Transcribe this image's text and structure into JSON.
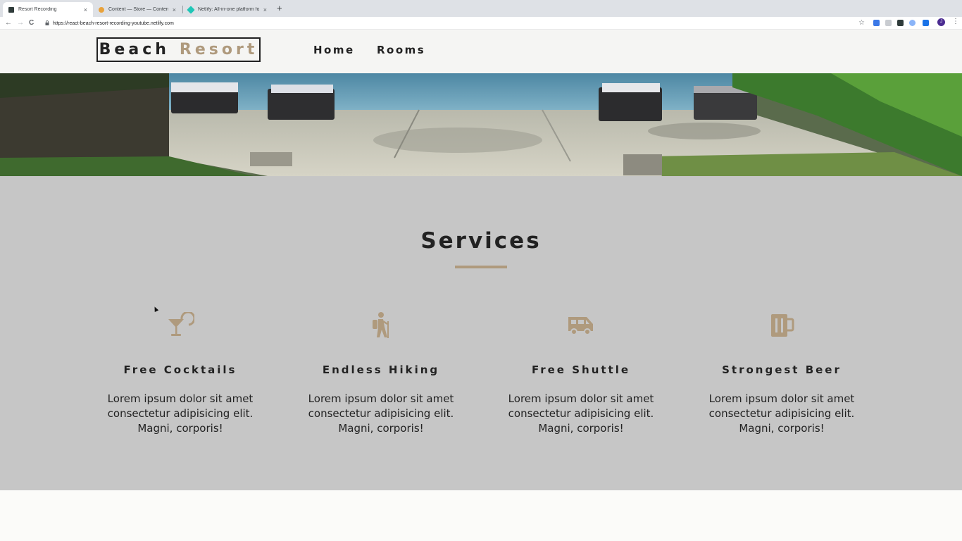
{
  "browser": {
    "tabs": [
      {
        "title": "Resort Recording",
        "active": true,
        "favicon_color": "#2f3b3a"
      },
      {
        "title": "Content — Store — Contentful",
        "active": false,
        "favicon_color": "#e9a23b"
      },
      {
        "title": "Netlify: All-in-one platform for",
        "active": false,
        "favicon_color": "#20c6b7"
      }
    ],
    "new_tab_label": "+",
    "close_glyph": "×",
    "url": "https://react-beach-resort-recording-youtube.netlify.com",
    "avatar_initial": "J",
    "back_glyph": "←",
    "forward_glyph": "→",
    "reload_glyph": "C",
    "star_glyph": "☆",
    "menu_glyph": "⋮",
    "lock_glyph": "🔒"
  },
  "navbar": {
    "logo_word1": "Beach",
    "logo_word2": "Resort",
    "links": [
      "Home",
      "Rooms"
    ]
  },
  "hero": {
    "image_description_icon": "pool-deck-photo"
  },
  "services": {
    "title": "Services",
    "items": [
      {
        "icon": "cocktail-icon",
        "title": "Free Cocktails",
        "text": "Lorem ipsum dolor sit amet consectetur adipisicing elit. Magni, corporis!"
      },
      {
        "icon": "hiking-icon",
        "title": "Endless Hiking",
        "text": "Lorem ipsum dolor sit amet consectetur adipisicing elit. Magni, corporis!"
      },
      {
        "icon": "shuttle-icon",
        "title": "Free Shuttle",
        "text": "Lorem ipsum dolor sit amet consectetur adipisicing elit. Magni, corporis!"
      },
      {
        "icon": "beer-icon",
        "title": "Strongest Beer",
        "text": "Lorem ipsum dolor sit amet consectetur adipisicing elit. Magni, corporis!"
      }
    ]
  },
  "colors": {
    "accent": "#af9a7d",
    "section_bg": "#c6c6c6",
    "text": "#222222"
  }
}
